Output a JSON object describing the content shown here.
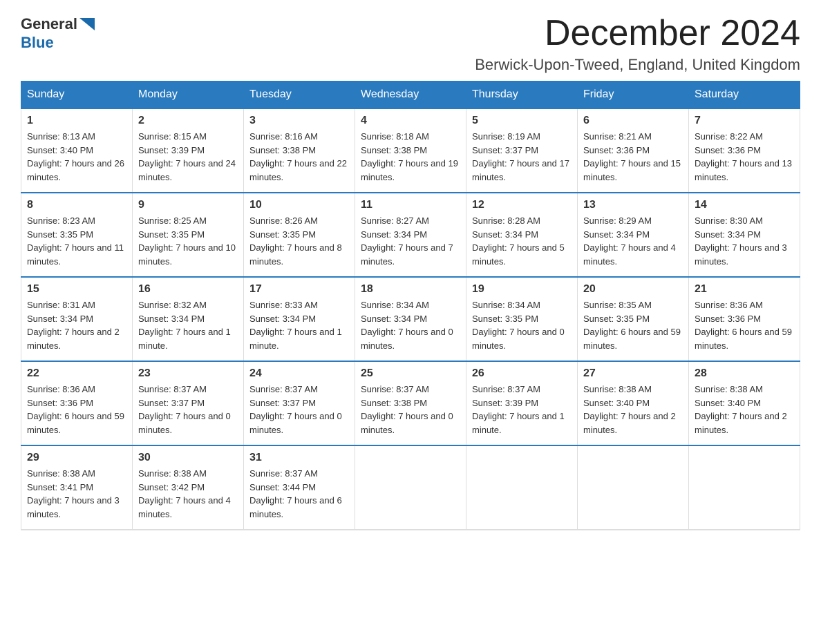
{
  "header": {
    "logo_general": "General",
    "logo_blue": "Blue",
    "month_title": "December 2024",
    "subtitle": "Berwick-Upon-Tweed, England, United Kingdom"
  },
  "weekdays": [
    "Sunday",
    "Monday",
    "Tuesday",
    "Wednesday",
    "Thursday",
    "Friday",
    "Saturday"
  ],
  "weeks": [
    [
      {
        "day": "1",
        "sunrise": "8:13 AM",
        "sunset": "3:40 PM",
        "daylight": "7 hours and 26 minutes."
      },
      {
        "day": "2",
        "sunrise": "8:15 AM",
        "sunset": "3:39 PM",
        "daylight": "7 hours and 24 minutes."
      },
      {
        "day": "3",
        "sunrise": "8:16 AM",
        "sunset": "3:38 PM",
        "daylight": "7 hours and 22 minutes."
      },
      {
        "day": "4",
        "sunrise": "8:18 AM",
        "sunset": "3:38 PM",
        "daylight": "7 hours and 19 minutes."
      },
      {
        "day": "5",
        "sunrise": "8:19 AM",
        "sunset": "3:37 PM",
        "daylight": "7 hours and 17 minutes."
      },
      {
        "day": "6",
        "sunrise": "8:21 AM",
        "sunset": "3:36 PM",
        "daylight": "7 hours and 15 minutes."
      },
      {
        "day": "7",
        "sunrise": "8:22 AM",
        "sunset": "3:36 PM",
        "daylight": "7 hours and 13 minutes."
      }
    ],
    [
      {
        "day": "8",
        "sunrise": "8:23 AM",
        "sunset": "3:35 PM",
        "daylight": "7 hours and 11 minutes."
      },
      {
        "day": "9",
        "sunrise": "8:25 AM",
        "sunset": "3:35 PM",
        "daylight": "7 hours and 10 minutes."
      },
      {
        "day": "10",
        "sunrise": "8:26 AM",
        "sunset": "3:35 PM",
        "daylight": "7 hours and 8 minutes."
      },
      {
        "day": "11",
        "sunrise": "8:27 AM",
        "sunset": "3:34 PM",
        "daylight": "7 hours and 7 minutes."
      },
      {
        "day": "12",
        "sunrise": "8:28 AM",
        "sunset": "3:34 PM",
        "daylight": "7 hours and 5 minutes."
      },
      {
        "day": "13",
        "sunrise": "8:29 AM",
        "sunset": "3:34 PM",
        "daylight": "7 hours and 4 minutes."
      },
      {
        "day": "14",
        "sunrise": "8:30 AM",
        "sunset": "3:34 PM",
        "daylight": "7 hours and 3 minutes."
      }
    ],
    [
      {
        "day": "15",
        "sunrise": "8:31 AM",
        "sunset": "3:34 PM",
        "daylight": "7 hours and 2 minutes."
      },
      {
        "day": "16",
        "sunrise": "8:32 AM",
        "sunset": "3:34 PM",
        "daylight": "7 hours and 1 minute."
      },
      {
        "day": "17",
        "sunrise": "8:33 AM",
        "sunset": "3:34 PM",
        "daylight": "7 hours and 1 minute."
      },
      {
        "day": "18",
        "sunrise": "8:34 AM",
        "sunset": "3:34 PM",
        "daylight": "7 hours and 0 minutes."
      },
      {
        "day": "19",
        "sunrise": "8:34 AM",
        "sunset": "3:35 PM",
        "daylight": "7 hours and 0 minutes."
      },
      {
        "day": "20",
        "sunrise": "8:35 AM",
        "sunset": "3:35 PM",
        "daylight": "6 hours and 59 minutes."
      },
      {
        "day": "21",
        "sunrise": "8:36 AM",
        "sunset": "3:36 PM",
        "daylight": "6 hours and 59 minutes."
      }
    ],
    [
      {
        "day": "22",
        "sunrise": "8:36 AM",
        "sunset": "3:36 PM",
        "daylight": "6 hours and 59 minutes."
      },
      {
        "day": "23",
        "sunrise": "8:37 AM",
        "sunset": "3:37 PM",
        "daylight": "7 hours and 0 minutes."
      },
      {
        "day": "24",
        "sunrise": "8:37 AM",
        "sunset": "3:37 PM",
        "daylight": "7 hours and 0 minutes."
      },
      {
        "day": "25",
        "sunrise": "8:37 AM",
        "sunset": "3:38 PM",
        "daylight": "7 hours and 0 minutes."
      },
      {
        "day": "26",
        "sunrise": "8:37 AM",
        "sunset": "3:39 PM",
        "daylight": "7 hours and 1 minute."
      },
      {
        "day": "27",
        "sunrise": "8:38 AM",
        "sunset": "3:40 PM",
        "daylight": "7 hours and 2 minutes."
      },
      {
        "day": "28",
        "sunrise": "8:38 AM",
        "sunset": "3:40 PM",
        "daylight": "7 hours and 2 minutes."
      }
    ],
    [
      {
        "day": "29",
        "sunrise": "8:38 AM",
        "sunset": "3:41 PM",
        "daylight": "7 hours and 3 minutes."
      },
      {
        "day": "30",
        "sunrise": "8:38 AM",
        "sunset": "3:42 PM",
        "daylight": "7 hours and 4 minutes."
      },
      {
        "day": "31",
        "sunrise": "8:37 AM",
        "sunset": "3:44 PM",
        "daylight": "7 hours and 6 minutes."
      },
      null,
      null,
      null,
      null
    ]
  ],
  "labels": {
    "sunrise": "Sunrise:",
    "sunset": "Sunset:",
    "daylight": "Daylight:"
  }
}
